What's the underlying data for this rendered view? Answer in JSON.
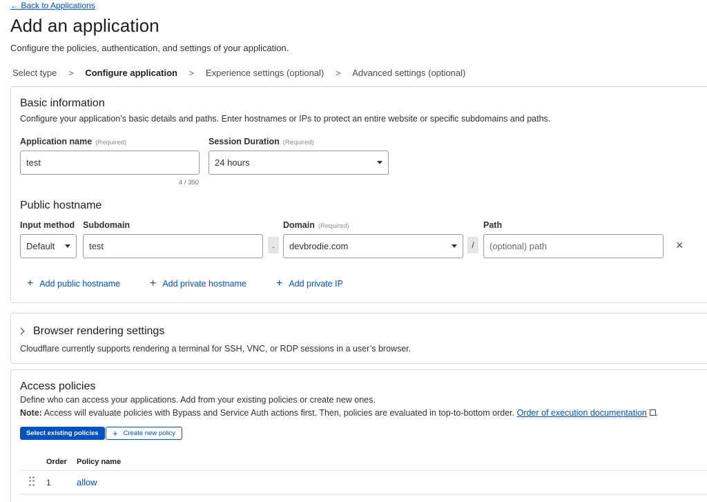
{
  "nav": {
    "back_label": "← Back to Applications"
  },
  "page": {
    "title": "Add an application",
    "subtitle": "Configure the policies, authentication, and settings of your application."
  },
  "steps": [
    {
      "label": "Select type"
    },
    {
      "label": "Configure application"
    },
    {
      "label": "Experience settings (optional)"
    },
    {
      "label": "Advanced settings (optional)"
    }
  ],
  "step_separator": ">",
  "basic": {
    "title": "Basic information",
    "description": "Configure your application’s basic details and paths. Enter hostnames or IPs to protect an entire website or specific subdomains and paths.",
    "app_name_label": "Application name",
    "app_name_value": "test",
    "app_name_count": "4 / 350",
    "session_label": "Session Duration",
    "session_value": "24 hours",
    "required_tag": "(Required)"
  },
  "hostname": {
    "title": "Public hostname",
    "input_method_label": "Input method",
    "input_method_value": "Default",
    "subdomain_label": "Subdomain",
    "subdomain_value": "test",
    "domain_label": "Domain",
    "domain_value": "devbrodie.com",
    "path_label": "Path",
    "path_placeholder": "(optional) path",
    "dot": ".",
    "slash": "/",
    "remove": "×",
    "add_public": "Add public hostname",
    "add_private": "Add private hostname",
    "add_ip": "Add private IP",
    "plus": "+"
  },
  "browser": {
    "title": "Browser rendering settings",
    "description": "Cloudflare currently supports rendering a terminal for SSH, VNC, or RDP sessions in a user’s browser."
  },
  "access": {
    "title": "Access policies",
    "description": "Define who can access your applications. Add from your existing policies or create new ones.",
    "note_label": "Note:",
    "note_text": " Access will evaluate policies with Bypass and Service Auth actions first. Then, policies are evaluated in top-to-bottom order. ",
    "doc_link": "Order of execution documentation",
    "period": ".",
    "select_existing": "Select existing policies",
    "create_new": "Create new policy",
    "columns": {
      "order": "Order",
      "policy_name": "Policy name"
    },
    "rows": [
      {
        "order": "1",
        "name": "allow"
      }
    ]
  }
}
